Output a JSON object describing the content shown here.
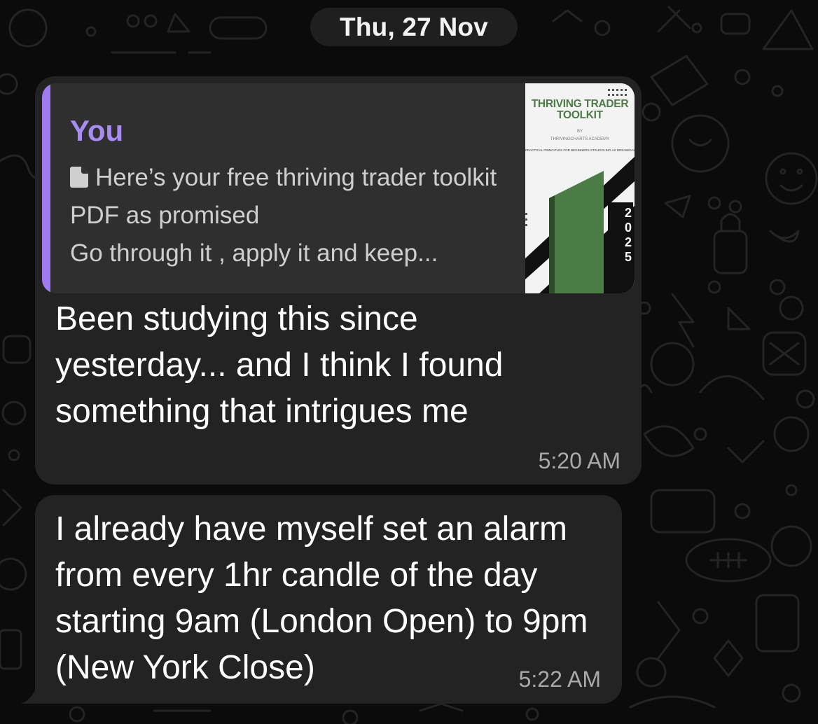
{
  "date_separator": "Thu, 27 Nov",
  "messages": [
    {
      "reply": {
        "author": "You",
        "icon": "document-icon",
        "text": "Here’s your free thriving trader toolkit PDF as promised\nGo through it , apply it and keep...",
        "thumbnail": {
          "title_line1": "THRIVING TRADER",
          "title_line2": "TOOLKIT",
          "by": "BY",
          "publisher": "THRIVINGCHARTS ACADEMY",
          "tagline": "PRACTICAL PRINCIPLES FOR BEGINNERS STRUGGLING AS DREAM/DAY TRADERS.",
          "year": "2025",
          "accent_color": "#4c7c45"
        }
      },
      "text": "Been studying this since yesterday... and I think I found something that intrigues me",
      "time": "5:20 AM"
    },
    {
      "text": "I already have myself set an alarm from every 1hr candle of the day starting 9am (London Open) to 9pm (New York Close)",
      "time": "5:22 AM"
    }
  ],
  "colors": {
    "background": "#0b0b0b",
    "bubble": "#232323",
    "quote": "#2f2f2f",
    "quote_accent": "#9d7bf0"
  }
}
